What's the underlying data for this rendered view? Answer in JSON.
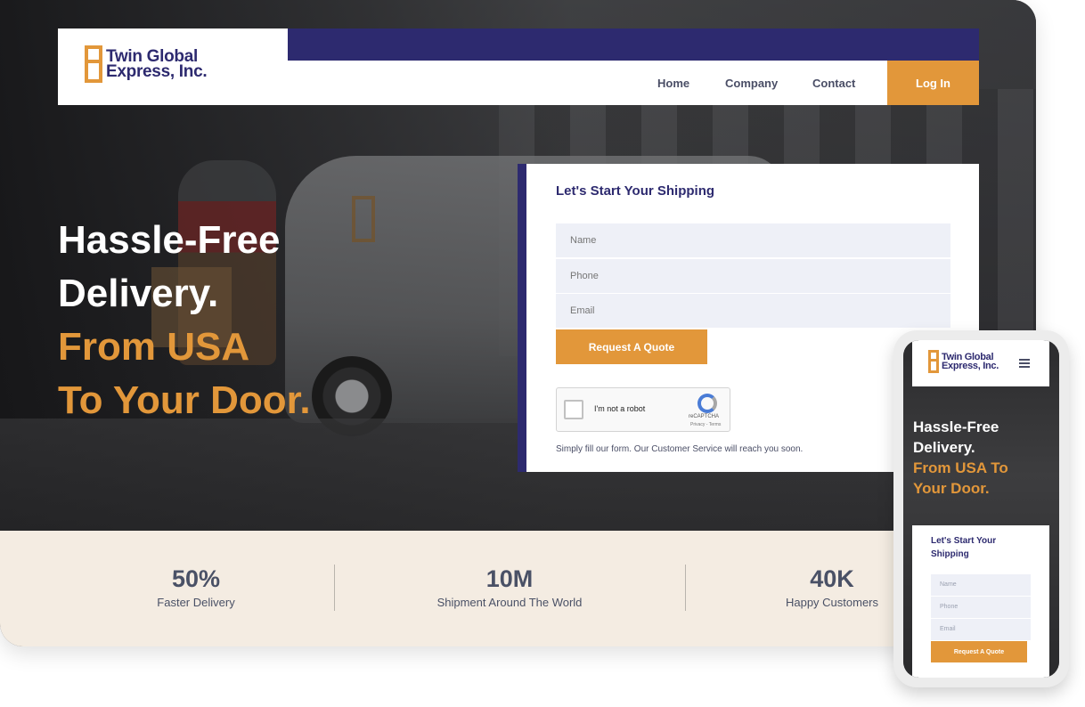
{
  "brand": {
    "name_line1": "Twin Global",
    "name_line2": "Express, Inc."
  },
  "nav": {
    "home": "Home",
    "company": "Company",
    "contact": "Contact",
    "login": "Log In"
  },
  "hero": {
    "line1": "Hassle-Free",
    "line2": "Delivery.",
    "line3": "From USA",
    "line4": "To Your Door."
  },
  "form": {
    "title": "Let's Start Your Shipping",
    "name_placeholder": "Name",
    "phone_placeholder": "Phone",
    "email_placeholder": "Email",
    "submit_label": "Request A Quote",
    "recaptcha_label": "I'm not a robot",
    "recaptcha_brand": "reCAPTCHA",
    "recaptcha_terms": "Privacy - Terms",
    "note": "Simply fill our form. Our Customer Service will reach you soon."
  },
  "stats": [
    {
      "value": "50%",
      "label": "Faster Delivery"
    },
    {
      "value": "10M",
      "label": "Shipment Around The World"
    },
    {
      "value": "40K",
      "label": "Happy Customers"
    }
  ],
  "mobile": {
    "headline_line1": "Hassle-Free",
    "headline_line2": "Delivery.",
    "headline_line3": "From USA To",
    "headline_line4": "Your Door.",
    "form_title": "Let's Start Your Shipping",
    "name_placeholder": "Name",
    "phone_placeholder": "Phone",
    "email_placeholder": "Email",
    "submit_label": "Request A Quote"
  },
  "colors": {
    "navy": "#2d2a6f",
    "orange": "#e2973a",
    "stats_bg": "#f4ece2"
  },
  "icons": {
    "menu": "hamburger-menu-icon",
    "logo": "twin-global-logo-mark",
    "captcha": "recaptcha-logo-icon"
  }
}
